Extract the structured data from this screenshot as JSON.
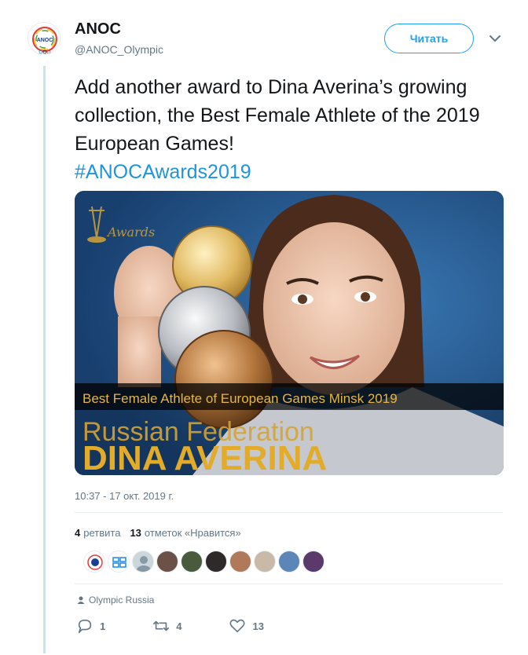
{
  "account": {
    "name": "ANOC",
    "handle": "@ANOC_Olympic",
    "avatar_text": "ANOC"
  },
  "follow_button": {
    "label": "Читать"
  },
  "tweet": {
    "text": "Add another award to Dina Averina’s growing collection, the Best Female Athlete of the 2019 European Games!",
    "hashtag": "#ANOCAwards2019"
  },
  "media": {
    "logo_text": "Awards",
    "caption_line": "Best Female Athlete of European Games Minsk 2019",
    "country": "Russian Federation",
    "athlete": "DINA AVERINA"
  },
  "timestamp": "10:37 - 17 окт. 2019 г.",
  "stats": {
    "retweets_count": "4",
    "retweets_label": "ретвита",
    "likes_count": "13",
    "likes_label": "отметок «Нравится»"
  },
  "source": {
    "label": "Olympic Russia",
    "icon": "person-icon"
  },
  "actions": {
    "reply_count": "1",
    "retweet_count": "4",
    "like_count": "13"
  },
  "colors": {
    "accent": "#1da1f2",
    "hashtag": "#1b95e0",
    "thread_line": "#c4e3f7",
    "gold_text": "#d4a437"
  }
}
